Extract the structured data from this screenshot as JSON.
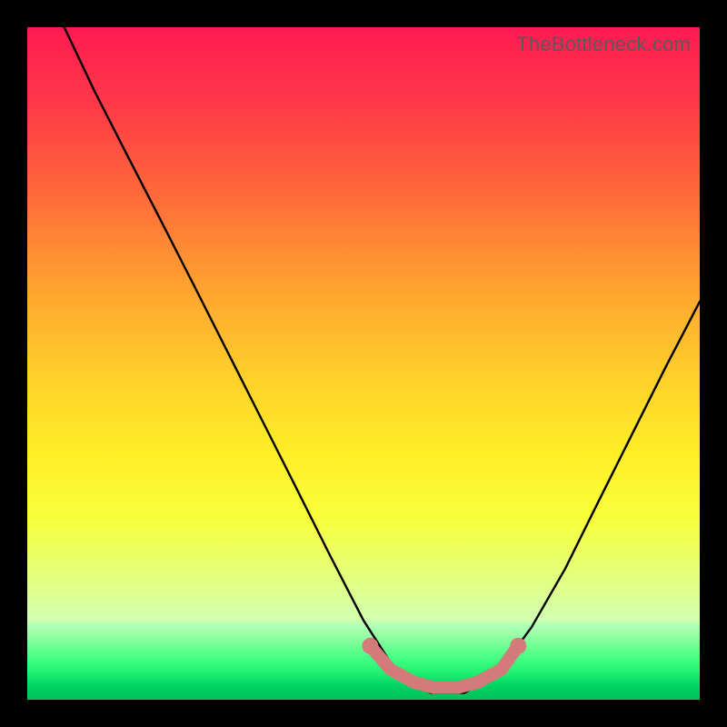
{
  "watermark": "TheBottleneck.com",
  "chart_data": {
    "type": "line",
    "title": "",
    "xlabel": "",
    "ylabel": "",
    "xlim": [
      0,
      1
    ],
    "ylim": [
      0,
      1
    ],
    "series": [
      {
        "name": "bottleneck-curve",
        "x": [
          0.055,
          0.1,
          0.15,
          0.2,
          0.25,
          0.3,
          0.35,
          0.4,
          0.45,
          0.5,
          0.55,
          0.6,
          0.65,
          0.7,
          0.75,
          0.8,
          0.85,
          0.9,
          0.95,
          1.0
        ],
        "values": [
          1.0,
          0.905,
          0.807,
          0.71,
          0.612,
          0.513,
          0.414,
          0.315,
          0.215,
          0.118,
          0.04,
          0.01,
          0.01,
          0.04,
          0.108,
          0.195,
          0.296,
          0.396,
          0.496,
          0.592
        ]
      },
      {
        "name": "highlight-band",
        "x": [
          0.51,
          0.54,
          0.575,
          0.605,
          0.64,
          0.67,
          0.705,
          0.73
        ],
        "values": [
          0.08,
          0.045,
          0.026,
          0.018,
          0.018,
          0.026,
          0.045,
          0.08
        ]
      }
    ],
    "colors": {
      "curve": "#000000",
      "highlight": "#d47a7a"
    }
  }
}
